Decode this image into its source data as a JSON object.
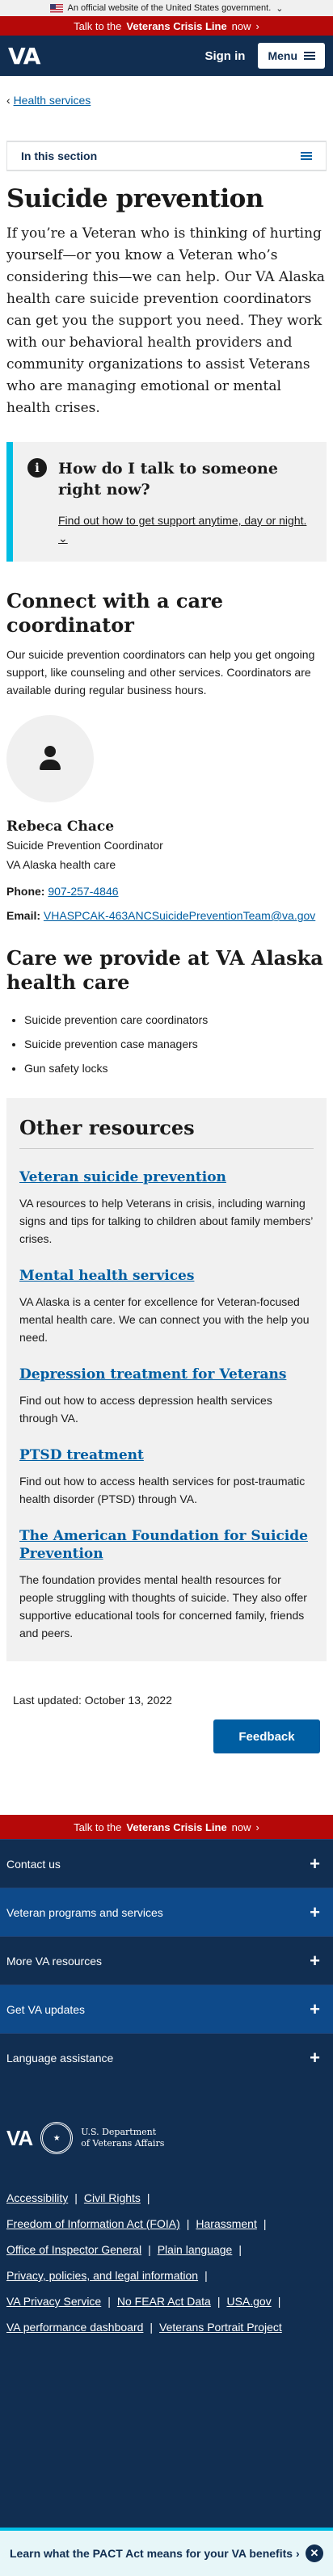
{
  "gov_banner": {
    "text": "An official website of the United States government.",
    "chevron": "chevron-down-icon"
  },
  "crisis_bar": {
    "prefix": "Talk to the",
    "bold": "Veterans Crisis Line",
    "suffix": "now",
    "arrow": "›"
  },
  "header": {
    "logo": "VA",
    "sign_in": "Sign in",
    "menu": "Menu"
  },
  "breadcrumb": {
    "label": "Health services",
    "arrow": "‹"
  },
  "in_section": {
    "label": "In this section"
  },
  "page": {
    "title": "Suicide prevention",
    "intro": "If you’re a Veteran who is thinking of hurting yourself—or you know a Veteran who’s considering this—we can help. Our VA Alaska health care suicide prevention coordinators can get you the support you need. They work with our behavioral health providers and community organizations to assist Veterans who are managing emotional or mental health crises."
  },
  "callout": {
    "icon": "info-icon",
    "heading": "How do I talk to someone right now?",
    "link": "Find out how to get support anytime, day or night."
  },
  "connect": {
    "heading": "Connect with a care coordinator",
    "text": "Our suicide prevention coordinators can help you get ongoing support, like counseling and other services. Coordinators are available during regular business hours.",
    "contact": {
      "name": "Rebeca Chace",
      "role": "Suicide Prevention Coordinator",
      "org": "VA Alaska health care",
      "phone_label": "Phone:",
      "phone": "907-257-4846",
      "email_label": "Email:",
      "email": "VHASPCAK-463ANCSuicidePreventionTeam@va.gov"
    }
  },
  "care": {
    "heading": "Care we provide at VA Alaska health care",
    "items": [
      "Suicide prevention care coordinators",
      "Suicide prevention case managers",
      "Gun safety locks"
    ]
  },
  "other": {
    "heading": "Other resources",
    "resources": [
      {
        "title": "Veteran suicide prevention",
        "text": "VA resources to help Veterans in crisis, including warning signs and tips for talking to children about family members’ crises."
      },
      {
        "title": "Mental health services",
        "text": "VA Alaska is a center for excellence for Veteran-focused mental health care. We can connect you with the help you need."
      },
      {
        "title": "Depression treatment for Veterans",
        "text": "Find out how to access depression health services through VA."
      },
      {
        "title": "PTSD treatment",
        "text": "Find out how to access health services for post-traumatic health disorder (PTSD) through VA."
      },
      {
        "title": "The American Foundation for Suicide Prevention",
        "text": "The foundation provides mental health resources for people struggling with thoughts of suicide. They also offer supportive educational tools for concerned family, friends and peers."
      }
    ]
  },
  "last_updated": "Last updated: October 13, 2022",
  "feedback": "Feedback",
  "footer": {
    "nav": [
      "Contact us",
      "Veteran programs and services",
      "More VA resources",
      "Get VA updates",
      "Language assistance"
    ],
    "logo": "VA",
    "dept": "U.S. Department of Veterans Affairs",
    "dept_line1": "U.S. Department",
    "dept_line2": "of Veterans Affairs",
    "links_rows": [
      [
        "Accessibility",
        "Civil Rights"
      ],
      [
        "Freedom of Information Act (FOIA)",
        "Harassment"
      ],
      [
        "Office of Inspector General",
        "Plain language"
      ],
      [
        "Privacy, policies, and legal information"
      ],
      [
        "VA Privacy Service",
        "No FEAR Act Data",
        "USA.gov"
      ],
      [
        "VA performance dashboard",
        "Veterans Portrait Project"
      ]
    ]
  },
  "pact": {
    "text": "Learn what the PACT Act means for your VA benefits",
    "arrow": "›",
    "close": "close-icon"
  }
}
